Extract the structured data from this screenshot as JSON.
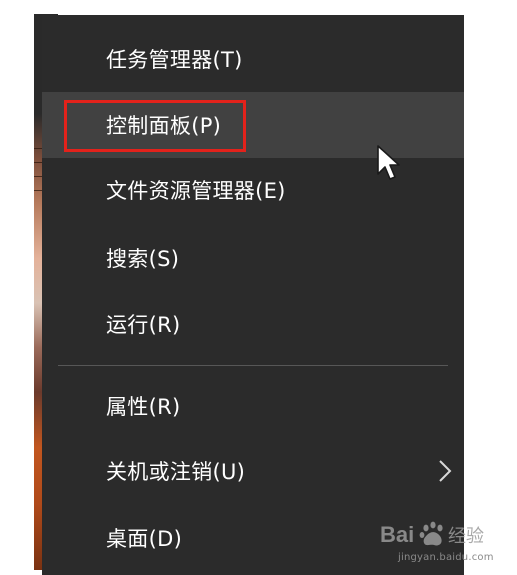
{
  "context_menu": {
    "items": [
      {
        "label": "任务管理器(T)"
      },
      {
        "label": "控制面板(P)"
      },
      {
        "label": "文件资源管理器(E)"
      },
      {
        "label": "搜索(S)"
      },
      {
        "label": "运行(R)"
      },
      {
        "label": "属性(R)"
      },
      {
        "label": "关机或注销(U)",
        "has_submenu": true
      },
      {
        "label": "桌面(D)"
      }
    ],
    "hovered_item": "控制面板(P)",
    "annotated_item": "控制面板(P)",
    "submenu_icon": "chevron-right-icon",
    "cursor_icon": "mouse-pointer-icon"
  },
  "watermark": {
    "logo": "Baidu 经验",
    "url": "jingyan.baidu.com"
  },
  "colors": {
    "menu_background": "#2b2b2b",
    "hover_background": "#414141",
    "highlight_border": "#e3221b",
    "text": "#ffffff",
    "separator": "#575757"
  }
}
